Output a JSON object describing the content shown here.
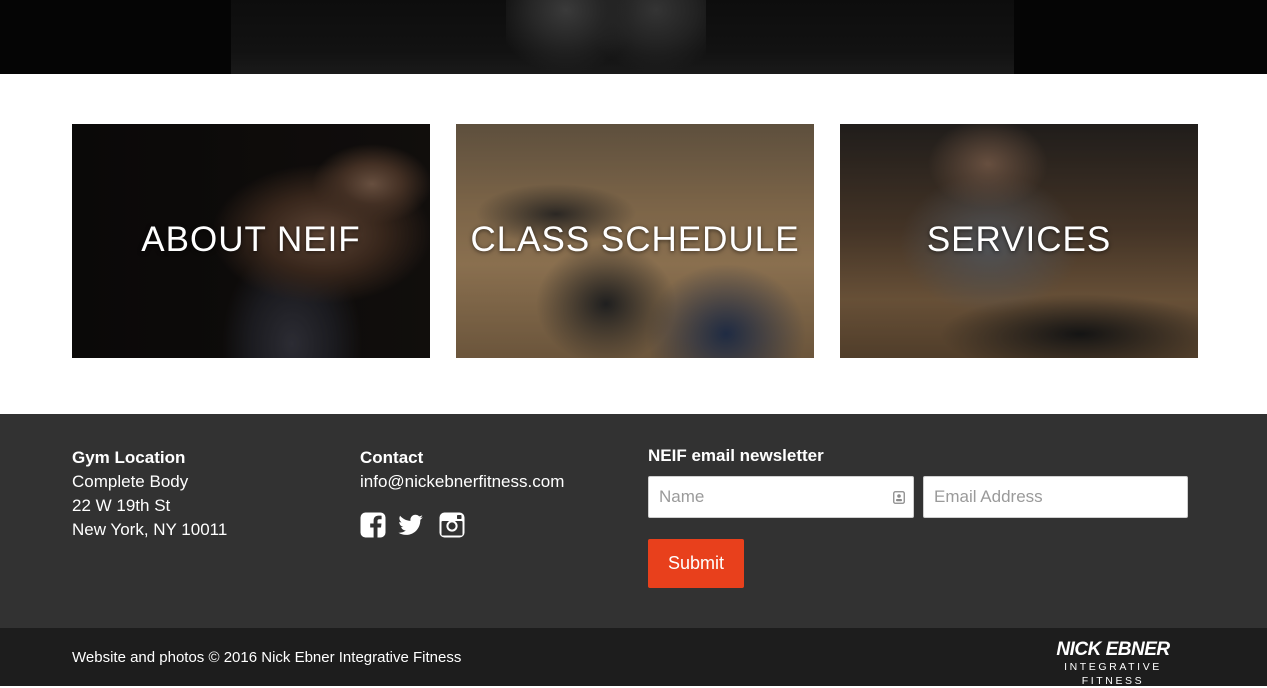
{
  "tiles": [
    {
      "label": "ABOUT NEIF"
    },
    {
      "label": "CLASS SCHEDULE"
    },
    {
      "label": "SERVICES"
    }
  ],
  "footer": {
    "location": {
      "heading": "Gym Location",
      "line1": "Complete Body",
      "line2": "22 W 19th St",
      "line3": "New York, NY 10011"
    },
    "contact": {
      "heading": "Contact",
      "email": "info@nickebnerfitness.com",
      "social_icons": [
        "facebook-icon",
        "twitter-icon",
        "instagram-icon"
      ]
    },
    "newsletter": {
      "heading": "NEIF email newsletter",
      "name_placeholder": "Name",
      "name_value": "",
      "email_placeholder": "Email Address",
      "email_value": "",
      "submit_label": "Submit"
    }
  },
  "bottom_bar": {
    "copyright": "Website and photos © 2016 Nick Ebner Integrative Fitness",
    "brand_name": "NICK EBNER",
    "brand_tagline": "INTEGRATIVE FITNESS"
  },
  "colors": {
    "footer_bg": "#323232",
    "bottom_bar_bg": "#1d1d1d",
    "submit_bg": "#e8401c",
    "text": "#ffffff"
  }
}
